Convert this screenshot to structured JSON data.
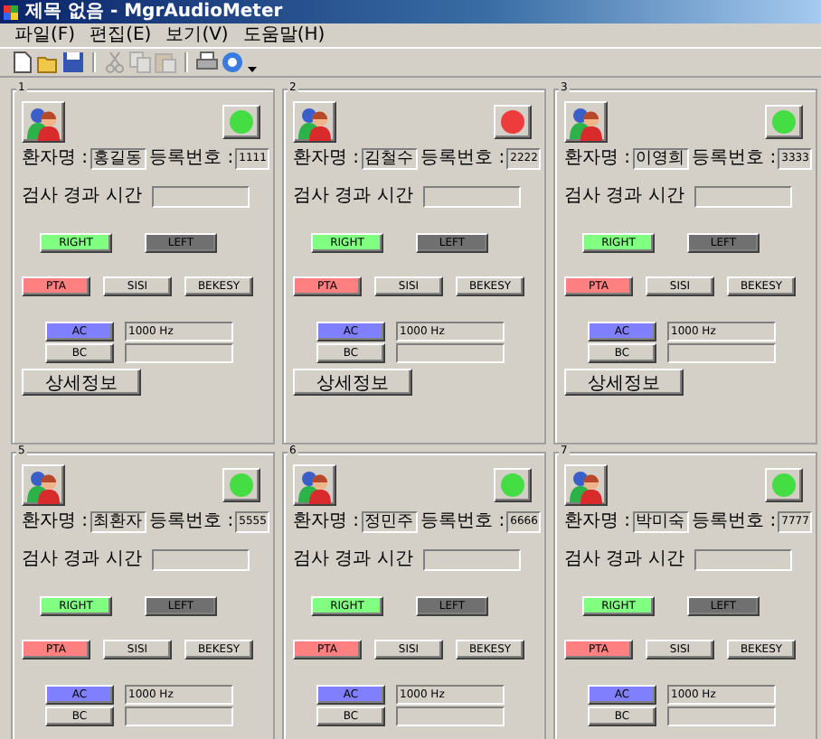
{
  "window": {
    "title": "제목 없음 - MgrAudioMeter"
  },
  "menu": [
    {
      "label": "파일(F)"
    },
    {
      "label": "편집(E)"
    },
    {
      "label": "보기(V)"
    },
    {
      "label": "도움말(H)"
    }
  ],
  "toolbar": [
    {
      "kind": "new",
      "disabled": false
    },
    {
      "kind": "open",
      "disabled": false
    },
    {
      "kind": "save",
      "disabled": false
    },
    {
      "kind": "sep"
    },
    {
      "kind": "cut",
      "disabled": true
    },
    {
      "kind": "copy",
      "disabled": true
    },
    {
      "kind": "paste",
      "disabled": true
    },
    {
      "kind": "sep"
    },
    {
      "kind": "print",
      "disabled": false
    },
    {
      "kind": "about",
      "disabled": false
    },
    {
      "kind": "more"
    }
  ],
  "panels": [
    {
      "number": "1",
      "status": {
        "color": "#44dd44"
      },
      "name_label": "환자명 :",
      "name": "홍길동",
      "id_label": "등록번호 :",
      "id": "1111",
      "time_label": "검사 경과 시간",
      "ears": [
        {
          "label": "RIGHT",
          "selected": true
        },
        {
          "label": "LEFT",
          "selected": false
        }
      ],
      "tests": [
        {
          "label": "PTA",
          "selected": true
        },
        {
          "label": "SISI",
          "selected": false
        },
        {
          "label": "BEKESY",
          "selected": false
        }
      ],
      "conduction": [
        {
          "label": "AC",
          "selected": true,
          "reading": "1000 Hz"
        },
        {
          "label": "BC",
          "selected": false
        }
      ],
      "detail_button": "상세정보"
    },
    {
      "number": "2",
      "status": {
        "color": "#ee3b3b"
      },
      "name_label": "환자명 :",
      "name": "김철수",
      "id_label": "등록번호 :",
      "id": "2222",
      "time_label": "검사 경과 시간",
      "ears": [
        {
          "label": "RIGHT",
          "selected": true
        },
        {
          "label": "LEFT",
          "selected": false
        }
      ],
      "tests": [
        {
          "label": "PTA",
          "selected": true
        },
        {
          "label": "SISI",
          "selected": false
        },
        {
          "label": "BEKESY",
          "selected": false
        }
      ],
      "conduction": [
        {
          "label": "AC",
          "selected": true,
          "reading": "1000 Hz"
        },
        {
          "label": "BC",
          "selected": false
        }
      ],
      "detail_button": "상세정보"
    },
    {
      "number": "3",
      "status": {
        "color": "#44dd44"
      },
      "name_label": "환자명 :",
      "name": "이영희",
      "id_label": "등록번호 :",
      "id": "3333",
      "time_label": "검사 경과 시간",
      "ears": [
        {
          "label": "RIGHT",
          "selected": true
        },
        {
          "label": "LEFT",
          "selected": false
        }
      ],
      "tests": [
        {
          "label": "PTA",
          "selected": true
        },
        {
          "label": "SISI",
          "selected": false
        },
        {
          "label": "BEKESY",
          "selected": false
        }
      ],
      "conduction": [
        {
          "label": "AC",
          "selected": true,
          "reading": "1000 Hz"
        },
        {
          "label": "BC",
          "selected": false
        }
      ],
      "detail_button": "상세정보"
    },
    {
      "number": "5",
      "status": {
        "color": "#44dd44"
      },
      "name_label": "환자명 :",
      "name": "최환자",
      "id_label": "등록번호 :",
      "id": "5555",
      "time_label": "검사 경과 시간",
      "ears": [
        {
          "label": "RIGHT",
          "selected": true
        },
        {
          "label": "LEFT",
          "selected": false
        }
      ],
      "tests": [
        {
          "label": "PTA",
          "selected": true
        },
        {
          "label": "SISI",
          "selected": false
        },
        {
          "label": "BEKESY",
          "selected": false
        }
      ],
      "conduction": [
        {
          "label": "AC",
          "selected": true,
          "reading": "1000 Hz"
        },
        {
          "label": "BC",
          "selected": false
        }
      ]
    },
    {
      "number": "6",
      "status": {
        "color": "#44dd44"
      },
      "name_label": "환자명 :",
      "name": "정민주",
      "id_label": "등록번호 :",
      "id": "6666",
      "time_label": "검사 경과 시간",
      "ears": [
        {
          "label": "RIGHT",
          "selected": true
        },
        {
          "label": "LEFT",
          "selected": false
        }
      ],
      "tests": [
        {
          "label": "PTA",
          "selected": true
        },
        {
          "label": "SISI",
          "selected": false
        },
        {
          "label": "BEKESY",
          "selected": false
        }
      ],
      "conduction": [
        {
          "label": "AC",
          "selected": true,
          "reading": "1000 Hz"
        },
        {
          "label": "BC",
          "selected": false
        }
      ]
    },
    {
      "number": "7",
      "status": {
        "color": "#44dd44"
      },
      "name_label": "환자명 :",
      "name": "박미숙",
      "id_label": "등록번호 :",
      "id": "7777",
      "time_label": "검사 경과 시간",
      "ears": [
        {
          "label": "RIGHT",
          "selected": true
        },
        {
          "label": "LEFT",
          "selected": false
        }
      ],
      "tests": [
        {
          "label": "PTA",
          "selected": true
        },
        {
          "label": "SISI",
          "selected": false
        },
        {
          "label": "BEKESY",
          "selected": false
        }
      ],
      "conduction": [
        {
          "label": "AC",
          "selected": true,
          "reading": "1000 Hz"
        },
        {
          "label": "BC",
          "selected": false
        }
      ]
    }
  ]
}
